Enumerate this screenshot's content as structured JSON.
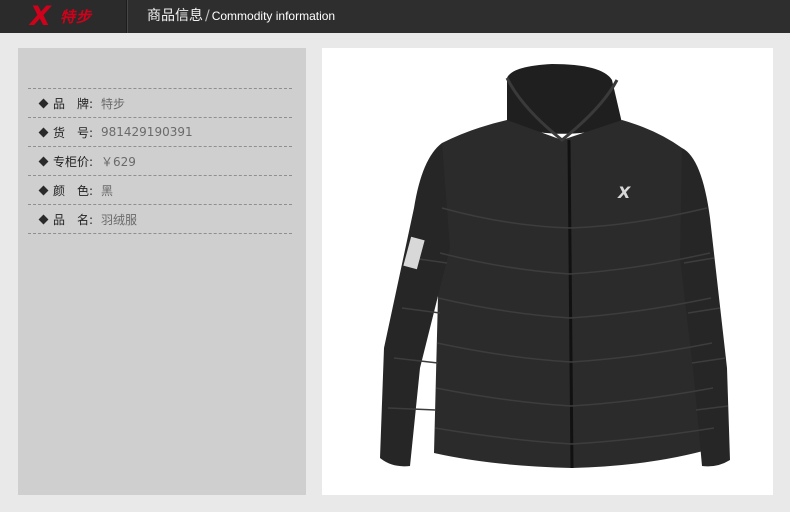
{
  "header": {
    "brand_logo_text": "特步",
    "title_cn": "商品信息",
    "separator": "/",
    "title_en": "Commodity information"
  },
  "info": {
    "rows": [
      {
        "label": "品　牌:",
        "value": "特步"
      },
      {
        "label": "货　号:",
        "value": "981429190391"
      },
      {
        "label": "专柜价:",
        "value": "￥629"
      },
      {
        "label": "颜　色:",
        "value": "黑"
      },
      {
        "label": "品　名:",
        "value": "羽绒服"
      }
    ]
  },
  "colors": {
    "brand_red": "#d0021b",
    "header_bg": "#2e2e2e",
    "panel_bg": "#cfcfcf",
    "jacket": "#2a2a2a"
  }
}
